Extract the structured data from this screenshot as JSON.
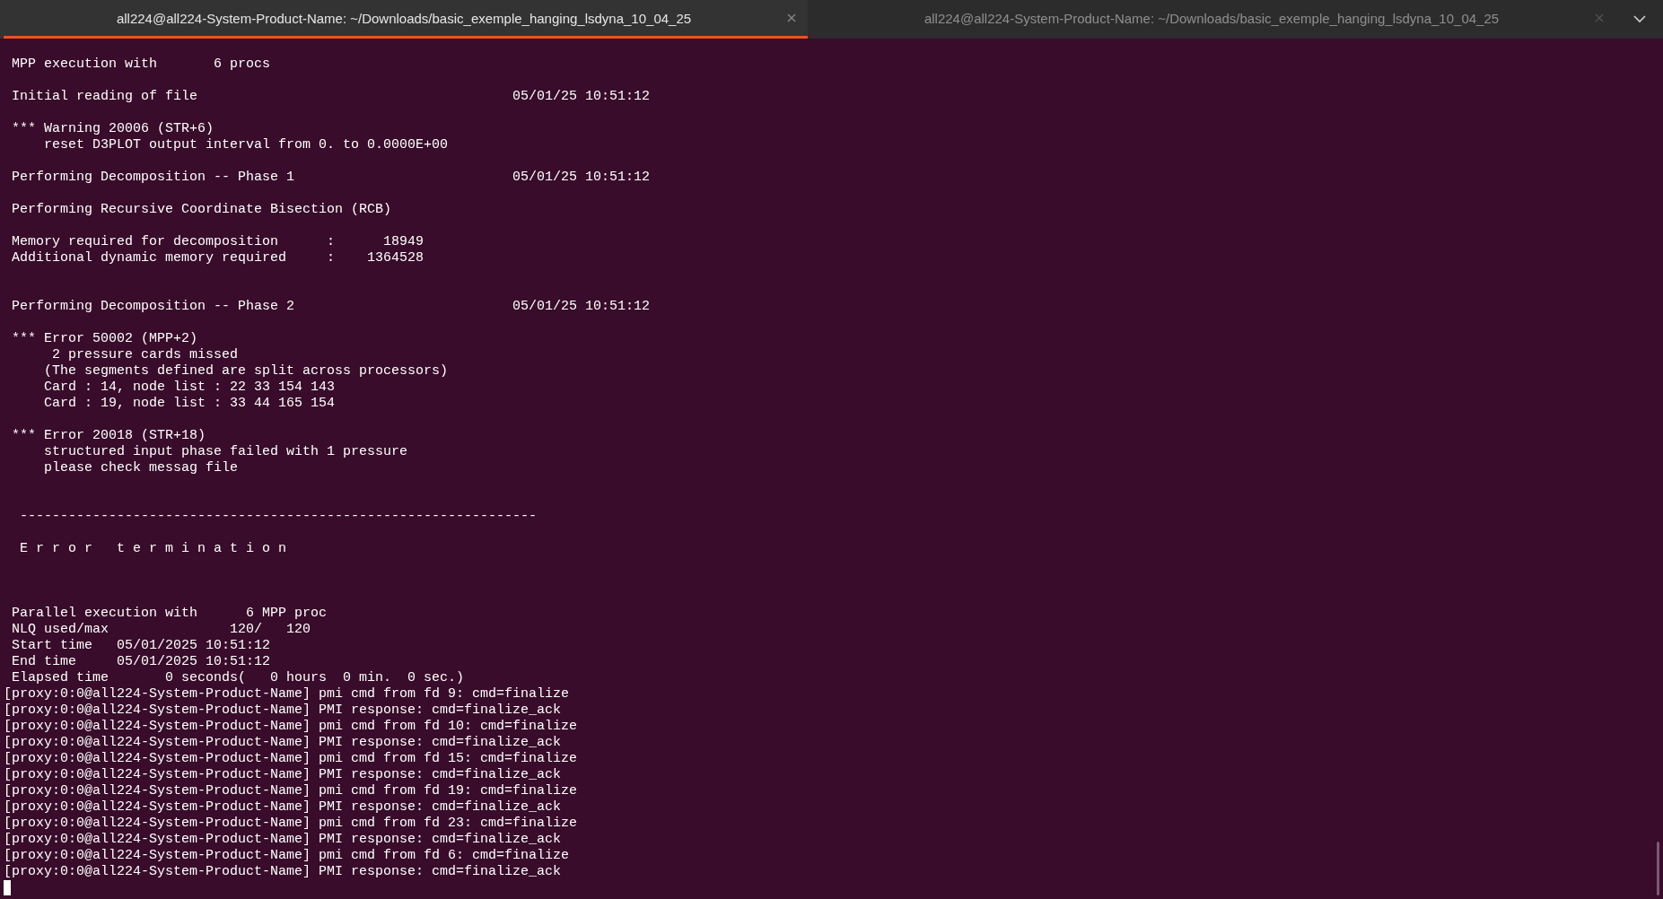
{
  "tabs": [
    {
      "title": "all224@all224-System-Product-Name: ~/Downloads/basic_exemple_hanging_lsdyna_10_04_25",
      "selected": true
    },
    {
      "title": "all224@all224-System-Product-Name: ~/Downloads/basic_exemple_hanging_lsdyna_10_04_25",
      "selected": false
    }
  ],
  "terminal": {
    "blocks": [
      {
        "kind": "top",
        "lines": [
          " MPP execution with       6 procs"
        ]
      },
      {
        "kind": "spaced",
        "lines": [
          " Initial reading of file                                       05/01/25 10:51:12"
        ]
      },
      {
        "kind": "spaced",
        "lines": [
          " *** Warning 20006 (STR+6)",
          "     reset D3PLOT output interval from 0. to 0.0000E+00"
        ]
      },
      {
        "kind": "spaced",
        "lines": [
          " Performing Decomposition -- Phase 1                           05/01/25 10:51:12"
        ]
      },
      {
        "kind": "spaced",
        "lines": [
          " Performing Recursive Coordinate Bisection (RCB)"
        ]
      },
      {
        "kind": "spaced",
        "lines": [
          " Memory required for decomposition      :      18949",
          " Additional dynamic memory required     :    1364528"
        ]
      },
      {
        "kind": "double_spaced",
        "lines": [
          " Performing Decomposition -- Phase 2                           05/01/25 10:51:12"
        ]
      },
      {
        "kind": "spaced",
        "lines": [
          " *** Error 50002 (MPP+2)",
          "      2 pressure cards missed",
          "     (The segments defined are split across processors)",
          "     Card : 14, node list : 22 33 154 143",
          "     Card : 19, node list : 33 44 165 154"
        ]
      },
      {
        "kind": "spaced",
        "lines": [
          " *** Error 20018 (STR+18)",
          "     structured input phase failed with 1 pressure",
          "     please check messag file"
        ]
      },
      {
        "kind": "double_spaced",
        "lines": [
          "  ----------------------------------------------------------------"
        ]
      },
      {
        "kind": "spaced",
        "lines": [
          "  E r r o r   t e r m i n a t i o n"
        ]
      },
      {
        "kind": "triple_spaced",
        "lines": [
          " Parallel execution with      6 MPP proc",
          " NLQ used/max               120/   120",
          " Start time   05/01/2025 10:51:12",
          " End time     05/01/2025 10:51:12",
          " Elapsed time       0 seconds(   0 hours  0 min.  0 sec.)",
          "[proxy:0:0@all224-System-Product-Name] pmi cmd from fd 9: cmd=finalize",
          "[proxy:0:0@all224-System-Product-Name] PMI response: cmd=finalize_ack",
          "[proxy:0:0@all224-System-Product-Name] pmi cmd from fd 10: cmd=finalize",
          "[proxy:0:0@all224-System-Product-Name] PMI response: cmd=finalize_ack",
          "[proxy:0:0@all224-System-Product-Name] pmi cmd from fd 15: cmd=finalize",
          "[proxy:0:0@all224-System-Product-Name] PMI response: cmd=finalize_ack",
          "[proxy:0:0@all224-System-Product-Name] pmi cmd from fd 19: cmd=finalize",
          "[proxy:0:0@all224-System-Product-Name] PMI response: cmd=finalize_ack",
          "[proxy:0:0@all224-System-Product-Name] pmi cmd from fd 23: cmd=finalize",
          "[proxy:0:0@all224-System-Product-Name] PMI response: cmd=finalize_ack",
          "[proxy:0:0@all224-System-Product-Name] pmi cmd from fd 6: cmd=finalize",
          "[proxy:0:0@all224-System-Product-Name] PMI response: cmd=finalize_ack"
        ]
      }
    ]
  }
}
